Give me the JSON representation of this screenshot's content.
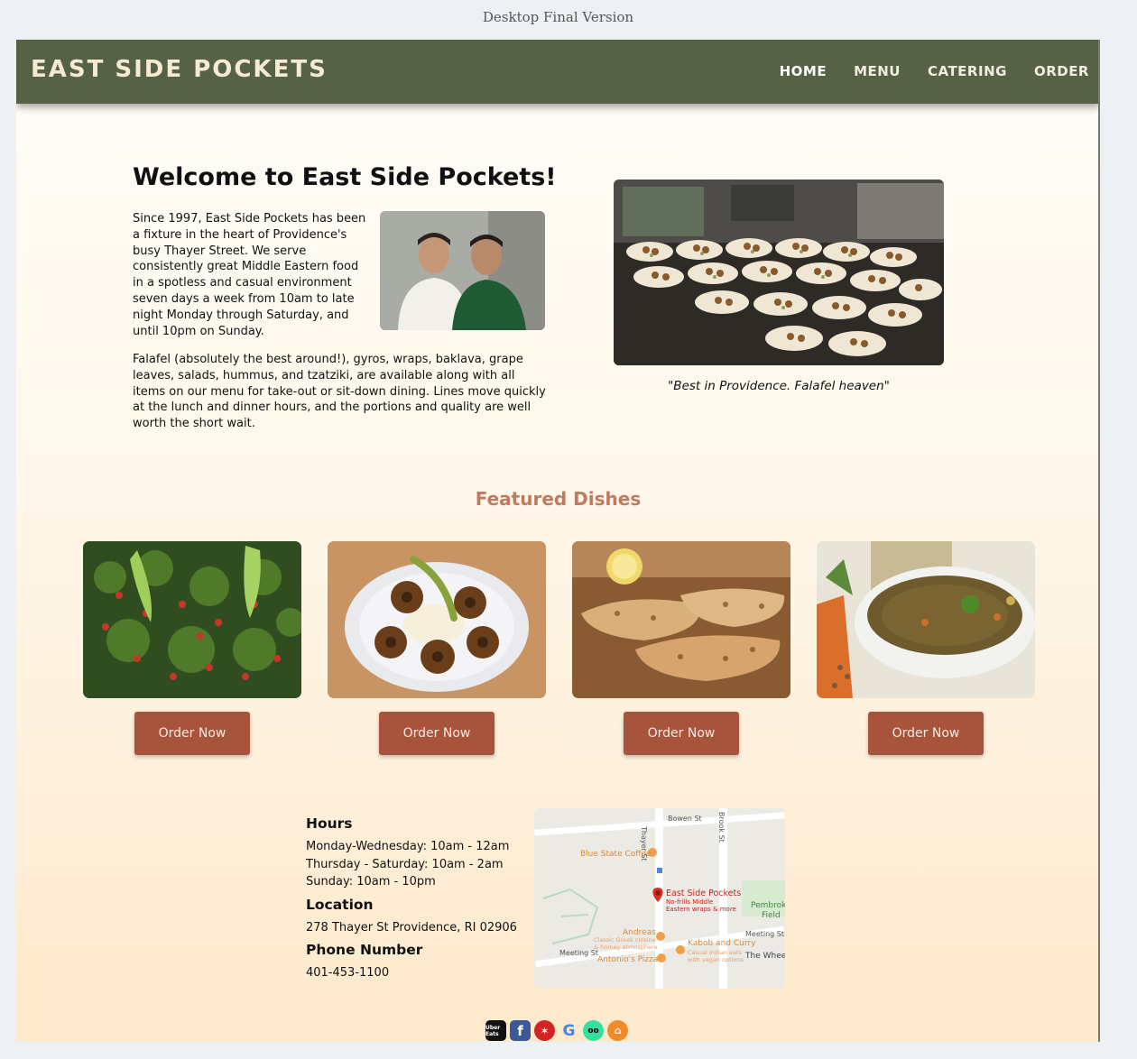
{
  "page_caption": "Desktop Final Version",
  "navbar": {
    "brand": "EAST SIDE POCKETS",
    "links": [
      "HOME",
      "MENU",
      "CATERING",
      "ORDER"
    ]
  },
  "welcome": {
    "title": "Welcome to East Side Pockets!",
    "p1": "Since 1997, East Side Pockets has been a fixture in the heart of Providence's busy Thayer Street. We serve consistently great Middle Eastern food in a spotless and casual environment seven days a week from 10am to late night Monday through Saturday, and until 10pm on Sunday.",
    "p2": "Falafel (absolutely the best around!), gyros, wraps, baklava, grape leaves, salads, hummus, and tzatziki, are available along with all items on our menu for take-out or sit-down dining. Lines move quickly at the lunch and dinner hours, and the portions and quality are well worth the short wait.",
    "quote": "\"Best in Providence. Falafel heaven\""
  },
  "featured": {
    "title": "Featured Dishes",
    "order_label": "Order Now"
  },
  "hours": {
    "title": "Hours",
    "lines": [
      "Monday-Wednesday: 10am - 12am",
      "Thursday - Saturday: 10am - 2am",
      "Sunday: 10am - 10pm"
    ]
  },
  "location": {
    "title": "Location",
    "address": "278 Thayer St Providence, RI 02906"
  },
  "phone": {
    "title": "Phone Number",
    "number": "401-453-1100"
  },
  "map": {
    "streets": [
      "Bowen St",
      "Thayer St",
      "Brook St",
      "Meeting St",
      "Meeting St"
    ],
    "places": {
      "blue_state": "Blue State Coffee",
      "esp_name": "East Side Pockets",
      "esp_desc1": "No-frills Middle",
      "esp_desc2": "Eastern wraps & more",
      "pembroke1": "Pembrok",
      "pembroke2": "Field",
      "andreas": "Andreas",
      "andreas_desc1": "Classic Greek cuisine",
      "andreas_desc2": "& homey atmosphere",
      "kabob": "Kabob and Curry",
      "kabob_desc1": "Casual Indian eats",
      "kabob_desc2": "with vegan options",
      "antonios": "Antonio's Pizza",
      "wheel": "The Wheel"
    }
  },
  "socials": {
    "ubereats": "Uber Eats",
    "facebook": "f",
    "yelp": "✶",
    "google": "G",
    "tripadvisor": "oo",
    "grubhub": "⌂"
  },
  "colors": {
    "navbar": "#566246",
    "brand_text": "#f7ead2",
    "accent_title": "#c07a5e",
    "button": "#a8543d"
  }
}
